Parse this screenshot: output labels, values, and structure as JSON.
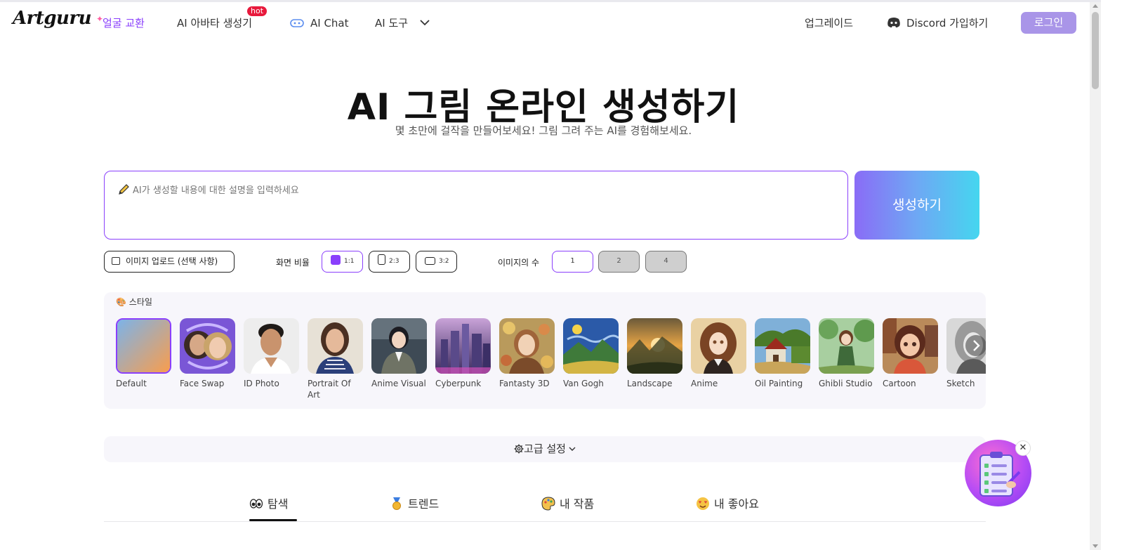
{
  "nav": {
    "logo": "Artguru",
    "face_swap": "얼굴 교환",
    "avatar": "AI 아바타 생성기",
    "hot_badge": "hot",
    "chat": "AI Chat",
    "tools": "AI 도구",
    "upgrade": "업그레이드",
    "discord": "Discord 가입하기",
    "login": "로그인"
  },
  "hero": {
    "title": "AI 그림 온라인 생성하기",
    "subtitle": "몇 초만에 걸작을 만들어보세요! 그림 그려 주는 AI를 경험해보세요."
  },
  "prompt": {
    "placeholder": "AI가 생성할 내용에 대한 설명을 입력하세요",
    "value": "",
    "generate": "생성하기"
  },
  "options": {
    "upload": "이미지 업로드 (선택 사항)",
    "ratio_label": "화면 비율",
    "ratios": [
      "1:1",
      "2:3",
      "3:2"
    ],
    "ratio_selected": "1:1",
    "count_label": "이미지의 수",
    "counts": [
      "1",
      "2",
      "4"
    ],
    "count_selected": "1"
  },
  "styles": {
    "heading": "스타일",
    "selected": "Default",
    "items": [
      {
        "name": "Default"
      },
      {
        "name": "Face Swap"
      },
      {
        "name": "ID Photo"
      },
      {
        "name": "Portrait Of Art"
      },
      {
        "name": "Anime Visual"
      },
      {
        "name": "Cyberpunk"
      },
      {
        "name": "Fantasty 3D"
      },
      {
        "name": "Van Gogh"
      },
      {
        "name": "Landscape"
      },
      {
        "name": "Anime"
      },
      {
        "name": "Oil Painting"
      },
      {
        "name": "Ghibli Studio"
      },
      {
        "name": "Cartoon"
      },
      {
        "name": "Sketch"
      }
    ]
  },
  "advanced": {
    "label": "고급 설정"
  },
  "tabs": {
    "explore": "탐색",
    "trend": "트렌드",
    "my_works": "내 작품",
    "my_likes": "내 좋아요",
    "active": "탐색"
  },
  "float_widget": {
    "close": "✕"
  },
  "colors": {
    "accent": "#8a3ffc",
    "login_bg": "#a995e8",
    "hot": "#e8193c"
  }
}
